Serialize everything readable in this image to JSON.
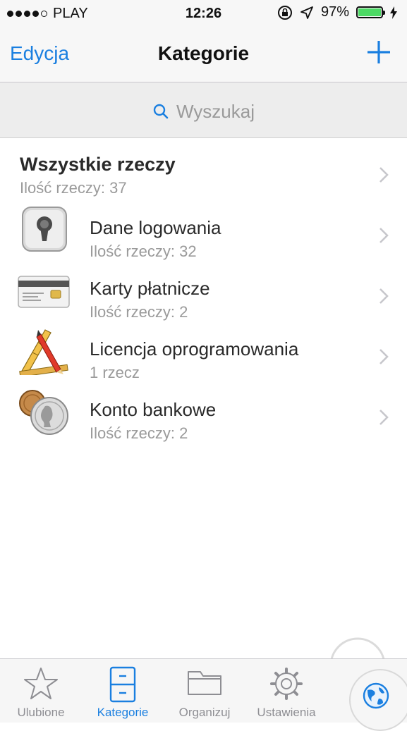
{
  "status_bar": {
    "carrier": "PLAY",
    "time": "12:26",
    "battery": "97%",
    "battery_level": 0.97,
    "battery_color": "#4cd964"
  },
  "nav": {
    "edit_label": "Edycja",
    "title": "Kategorie",
    "add_icon": "plus-icon"
  },
  "search": {
    "placeholder": "Wyszukaj",
    "icon": "search-icon"
  },
  "all_items": {
    "name": "Wszystkie rzeczy",
    "count": "Ilość rzeczy: 37"
  },
  "categories": [
    {
      "name": "Dane logowania",
      "count": "Ilość rzeczy: 32",
      "icon": "keyhole-icon"
    },
    {
      "name": "Karty płatnicze",
      "count": "Ilość rzeczy: 2",
      "icon": "credit-card-icon"
    },
    {
      "name": "Licencja oprogramowania",
      "count": "1 rzecz",
      "icon": "pencil-ruler-icon"
    },
    {
      "name": "Konto bankowe",
      "count": "Ilość rzeczy: 2",
      "icon": "coins-icon"
    }
  ],
  "tabs": [
    {
      "label": "Ulubione",
      "icon": "star-icon"
    },
    {
      "label": "Kategorie",
      "icon": "cabinet-icon",
      "active": true
    },
    {
      "label": "Organizuj",
      "icon": "folder-icon"
    },
    {
      "label": "Ustawienia",
      "icon": "gear-icon"
    }
  ],
  "globe_button": {
    "icon": "globe-icon"
  },
  "colors": {
    "accent": "#1a7fe0",
    "secondary_text": "#9a9a9a"
  }
}
